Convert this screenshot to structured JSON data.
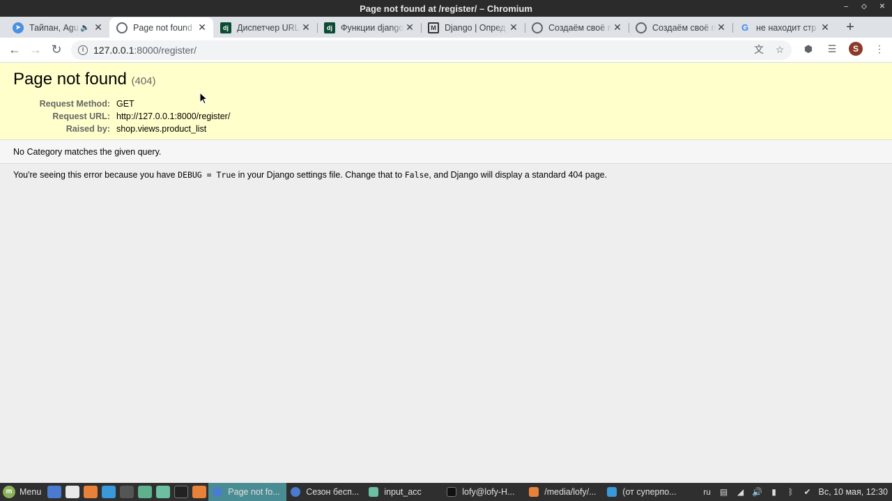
{
  "window": {
    "title": "Page not found at /register/ – Chromium"
  },
  "tabs": [
    {
      "label": "Тайпан, Agu",
      "icon": "telegram-icon",
      "audio": true,
      "active": false
    },
    {
      "label": "Page not found",
      "icon": "globe-icon",
      "active": true
    },
    {
      "label": "Диспетчер URL",
      "icon": "django-icon",
      "active": false
    },
    {
      "label": "Функции django",
      "icon": "django-icon",
      "active": false
    },
    {
      "label": "Django | Опред",
      "icon": "mdn-icon",
      "active": false
    },
    {
      "label": "Создаём своё п",
      "icon": "globe-icon",
      "active": false
    },
    {
      "label": "Создаём своё п",
      "icon": "globe-icon",
      "active": false
    },
    {
      "label": "не находит стр",
      "icon": "google-icon",
      "active": false
    }
  ],
  "address_bar": {
    "host": "127.0.0.1",
    "path": ":8000/register/"
  },
  "profile": {
    "initial": "S"
  },
  "page": {
    "title": "Page not found",
    "code": "(404)",
    "meta": [
      {
        "key": "Request Method:",
        "value": "GET"
      },
      {
        "key": "Request URL:",
        "value": "http://127.0.0.1:8000/register/"
      },
      {
        "key": "Raised by:",
        "value": "shop.views.product_list"
      }
    ],
    "message": "No Category matches the given query.",
    "explanation": {
      "part1": "You're seeing this error because you have ",
      "code1": "DEBUG = True",
      "part2": " in your Django settings file. Change that to ",
      "code2": "False",
      "part3": ", and Django will display a standard 404 page."
    }
  },
  "taskbar": {
    "menu_label": "Menu",
    "tasks": [
      {
        "label": "Page not fo...",
        "active": true
      },
      {
        "label": "Сезон бесп...",
        "active": false
      },
      {
        "label": "input_acc",
        "active": false
      },
      {
        "label": "lofy@lofy-H...",
        "active": false
      },
      {
        "label": "/media/lofy/...",
        "active": false
      },
      {
        "label": "(от суперпо...",
        "active": false
      }
    ],
    "lang": "ru",
    "clock": "Вс, 10 мая, 12:30"
  }
}
